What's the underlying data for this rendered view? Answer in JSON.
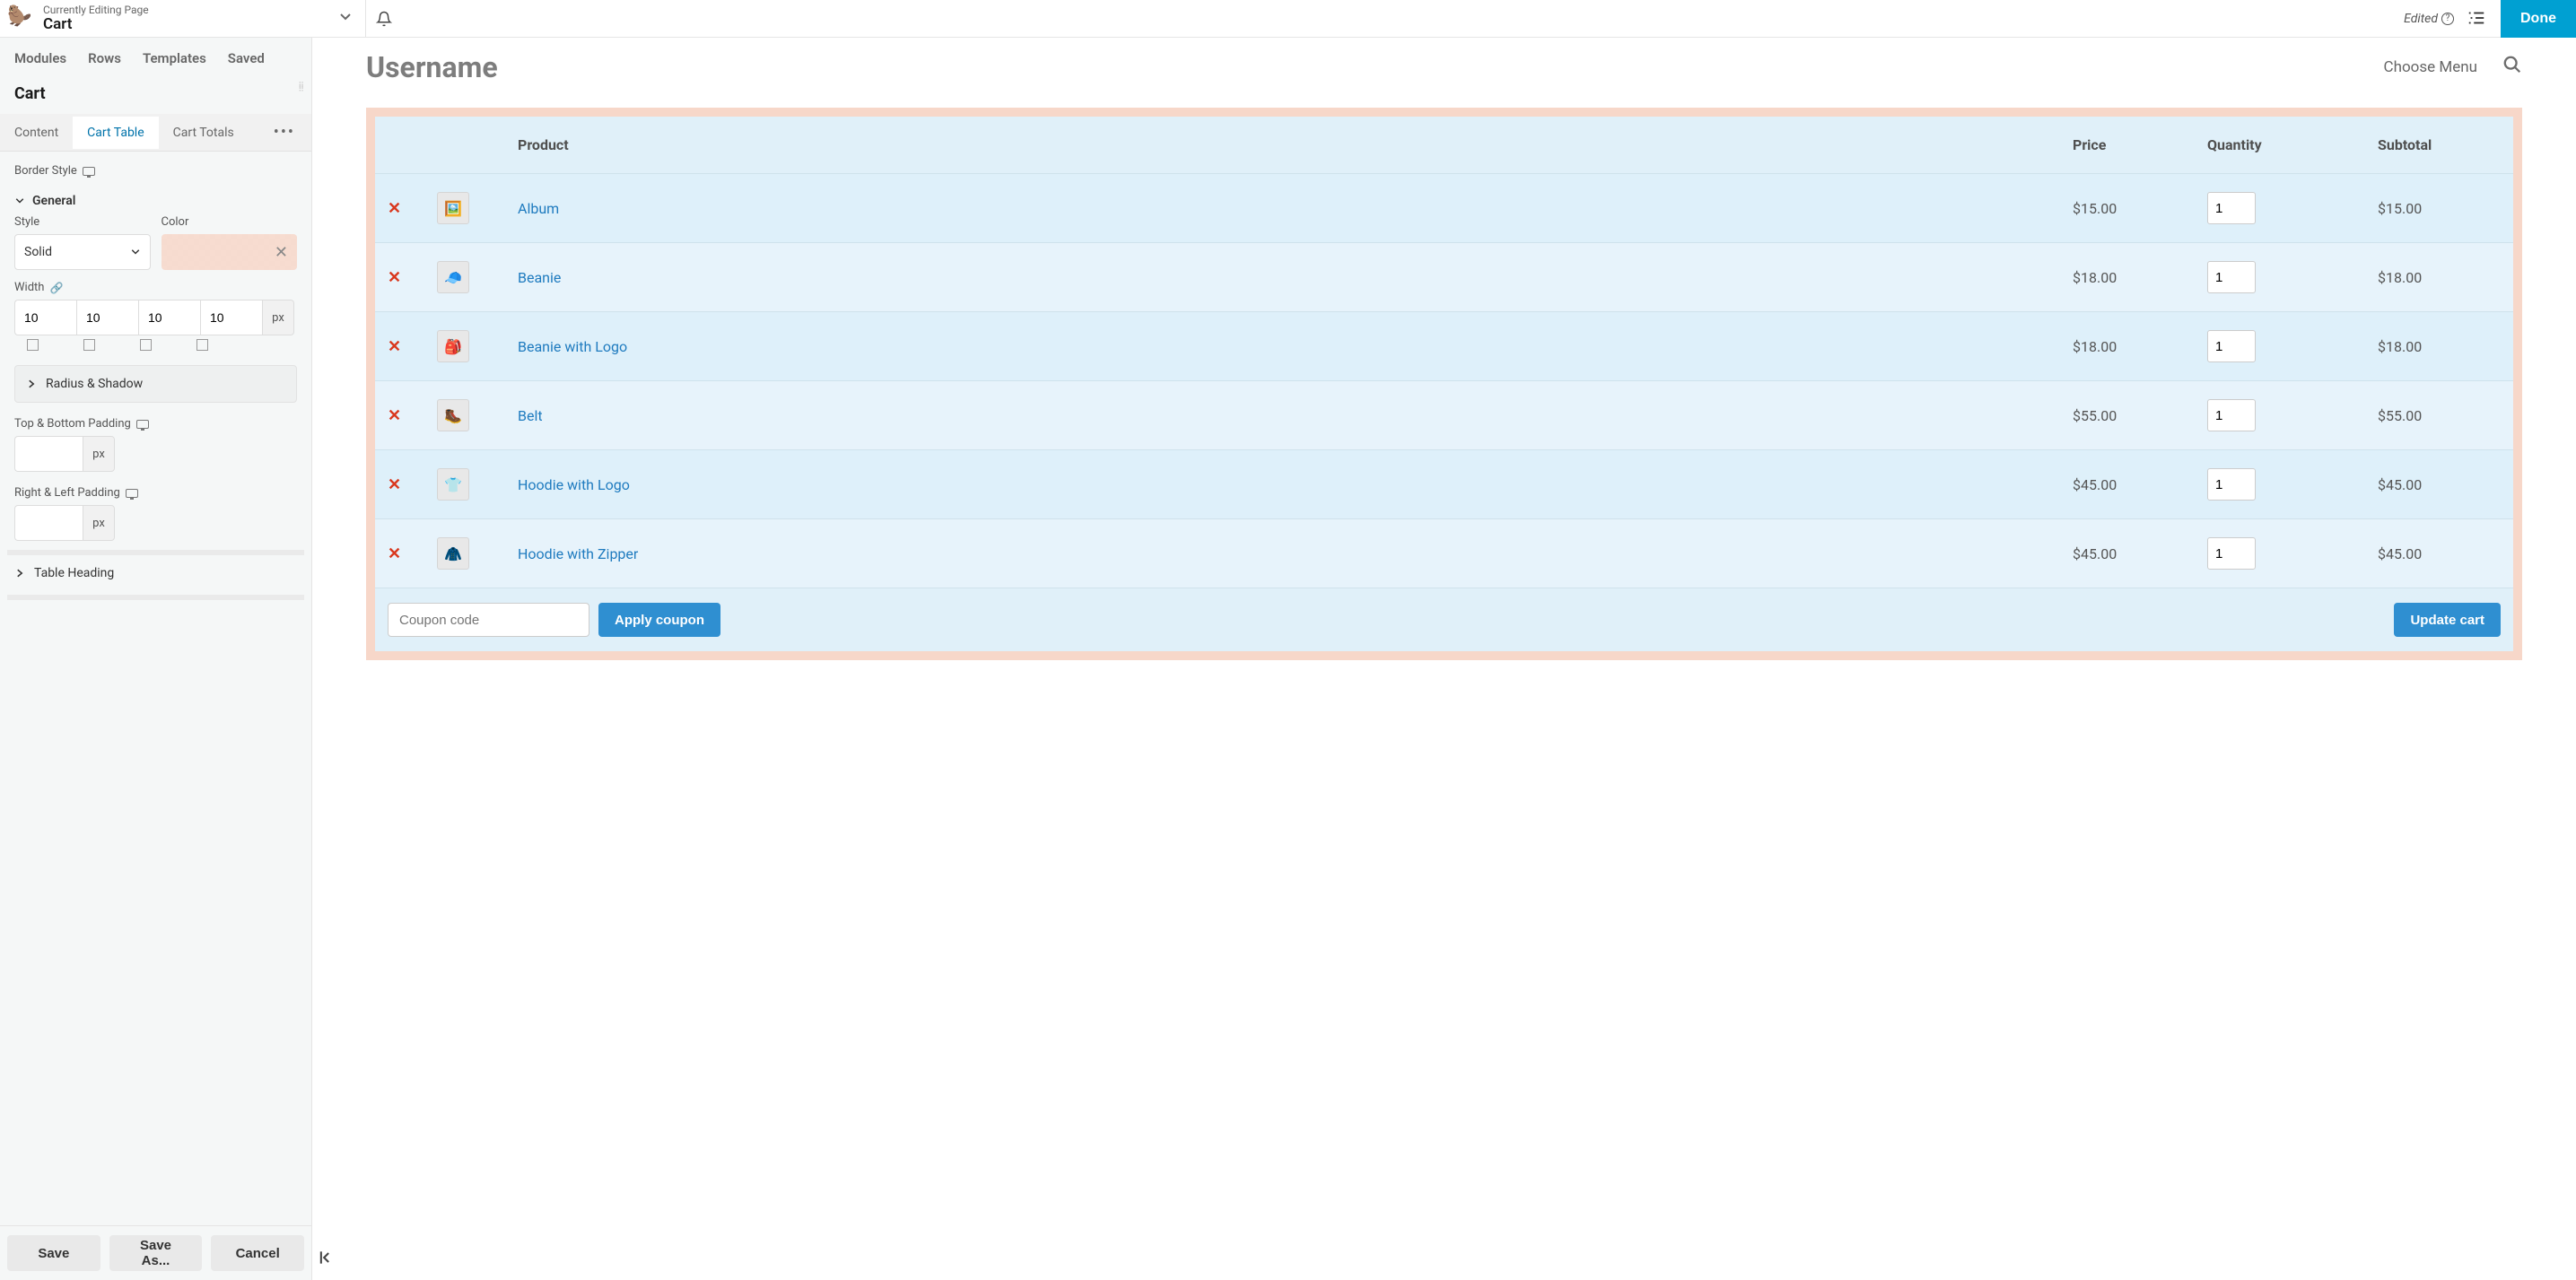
{
  "topbar": {
    "subtitle": "Currently Editing Page",
    "title": "Cart",
    "edited_label": "Edited",
    "done_label": "Done"
  },
  "panel_tabs": {
    "modules": "Modules",
    "rows": "Rows",
    "templates": "Templates",
    "saved": "Saved"
  },
  "module_title": "Cart",
  "sub_tabs": {
    "content": "Content",
    "cart_table": "Cart Table",
    "cart_totals": "Cart Totals"
  },
  "settings": {
    "border_style_label": "Border Style",
    "general_label": "General",
    "style_label": "Style",
    "style_value": "Solid",
    "color_label": "Color",
    "color_value": "#f7d7c9",
    "width_label": "Width",
    "width_values": [
      "10",
      "10",
      "10",
      "10"
    ],
    "width_unit": "px",
    "radius_shadow_label": "Radius & Shadow",
    "tb_padding_label": "Top & Bottom Padding",
    "tb_padding_unit": "px",
    "rl_padding_label": "Right & Left Padding",
    "rl_padding_unit": "px",
    "table_heading_label": "Table Heading"
  },
  "sidebar_footer": {
    "save": "Save",
    "save_as": "Save As...",
    "cancel": "Cancel"
  },
  "preview": {
    "username": "Username",
    "choose_menu": "Choose Menu",
    "headers": {
      "product": "Product",
      "price": "Price",
      "quantity": "Quantity",
      "subtotal": "Subtotal"
    },
    "rows": [
      {
        "thumb": "🖼️",
        "name": "Album",
        "price": "$15.00",
        "qty": "1",
        "subtotal": "$15.00"
      },
      {
        "thumb": "🧢",
        "name": "Beanie",
        "price": "$18.00",
        "qty": "1",
        "subtotal": "$18.00"
      },
      {
        "thumb": "🎒",
        "name": "Beanie with Logo",
        "price": "$18.00",
        "qty": "1",
        "subtotal": "$18.00"
      },
      {
        "thumb": "🥾",
        "name": "Belt",
        "price": "$55.00",
        "qty": "1",
        "subtotal": "$55.00"
      },
      {
        "thumb": "👕",
        "name": "Hoodie with Logo",
        "price": "$45.00",
        "qty": "1",
        "subtotal": "$45.00"
      },
      {
        "thumb": "🧥",
        "name": "Hoodie with Zipper",
        "price": "$45.00",
        "qty": "1",
        "subtotal": "$45.00"
      }
    ],
    "coupon_placeholder": "Coupon code",
    "apply_coupon": "Apply coupon",
    "update_cart": "Update cart"
  }
}
